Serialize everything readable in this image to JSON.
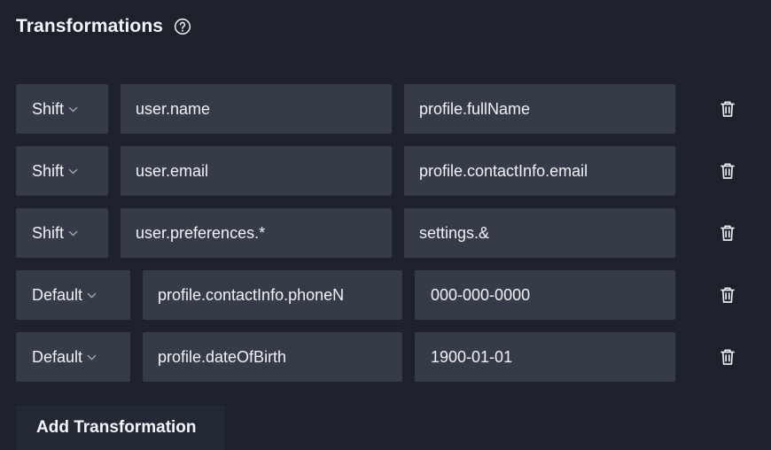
{
  "header": {
    "title": "Transformations",
    "help_icon": "help-circle-icon"
  },
  "rows": [
    {
      "operation": "Shift",
      "from": "user.name",
      "to": "profile.fullName"
    },
    {
      "operation": "Shift",
      "from": "user.email",
      "to": "profile.contactInfo.email"
    },
    {
      "operation": "Shift",
      "from": "user.preferences.*",
      "to": "settings.&"
    },
    {
      "operation": "Default",
      "from": "profile.contactInfo.phoneN",
      "to": "000-000-0000"
    },
    {
      "operation": "Default",
      "from": "profile.dateOfBirth",
      "to": "1900-01-01"
    }
  ],
  "row_icons": {
    "delete": "trash-icon",
    "dropdown": "chevron-down-icon"
  },
  "add_button_label": "Add Transformation",
  "colors": {
    "background": "#1c212c",
    "field": "#353b48",
    "text": "#f1f3f6",
    "add_button": "#222834"
  }
}
